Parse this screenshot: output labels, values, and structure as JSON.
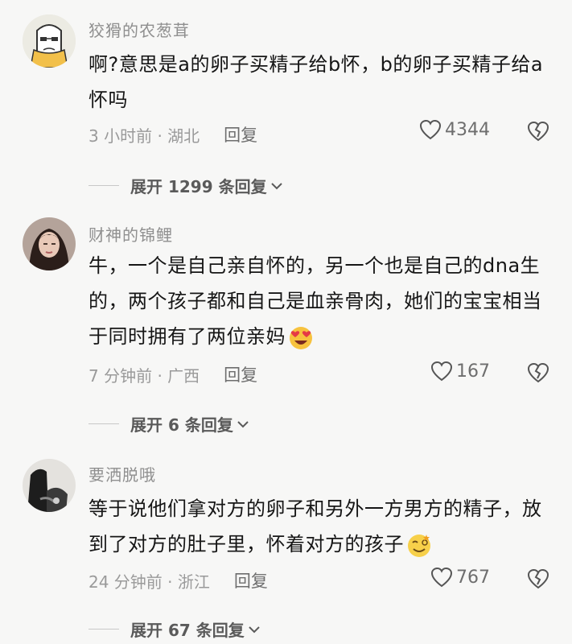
{
  "comments": [
    {
      "author": "狡猾的农葱茸",
      "text": "啊?意思是a的卵子买精子给b怀，b的卵子买精子给a怀吗",
      "time": "3 小时前 · 湖北",
      "reply_label": "回复",
      "likes": "4344",
      "expand_label": "展开 1299 条回复",
      "avatar_icon": "cartoon-face-icon"
    },
    {
      "author": "财神的锦鲤",
      "text": "牛，一个是自己亲自怀的，另一个也是自己的dna生的，两个孩子都和自己是血亲骨肉，她们的宝宝相当于同时拥有了两位亲妈",
      "emoji": "heart-eyes-emoji",
      "time": "7 分钟前 · 广西",
      "reply_label": "回复",
      "likes": "167",
      "expand_label": "展开 6 条回复",
      "avatar_icon": "woman-photo-avatar"
    },
    {
      "author": "要洒脱哦",
      "text": "等于说他们拿对方的卵子和另外一方男方的精子，放到了对方的肚子里，怀着对方的孩子",
      "emoji": "dizzy-smile-emoji",
      "time": "24 分钟前 · 浙江",
      "reply_label": "回复",
      "likes": "767",
      "expand_label": "展开 67 条回复",
      "avatar_icon": "dark-photo-avatar"
    }
  ]
}
